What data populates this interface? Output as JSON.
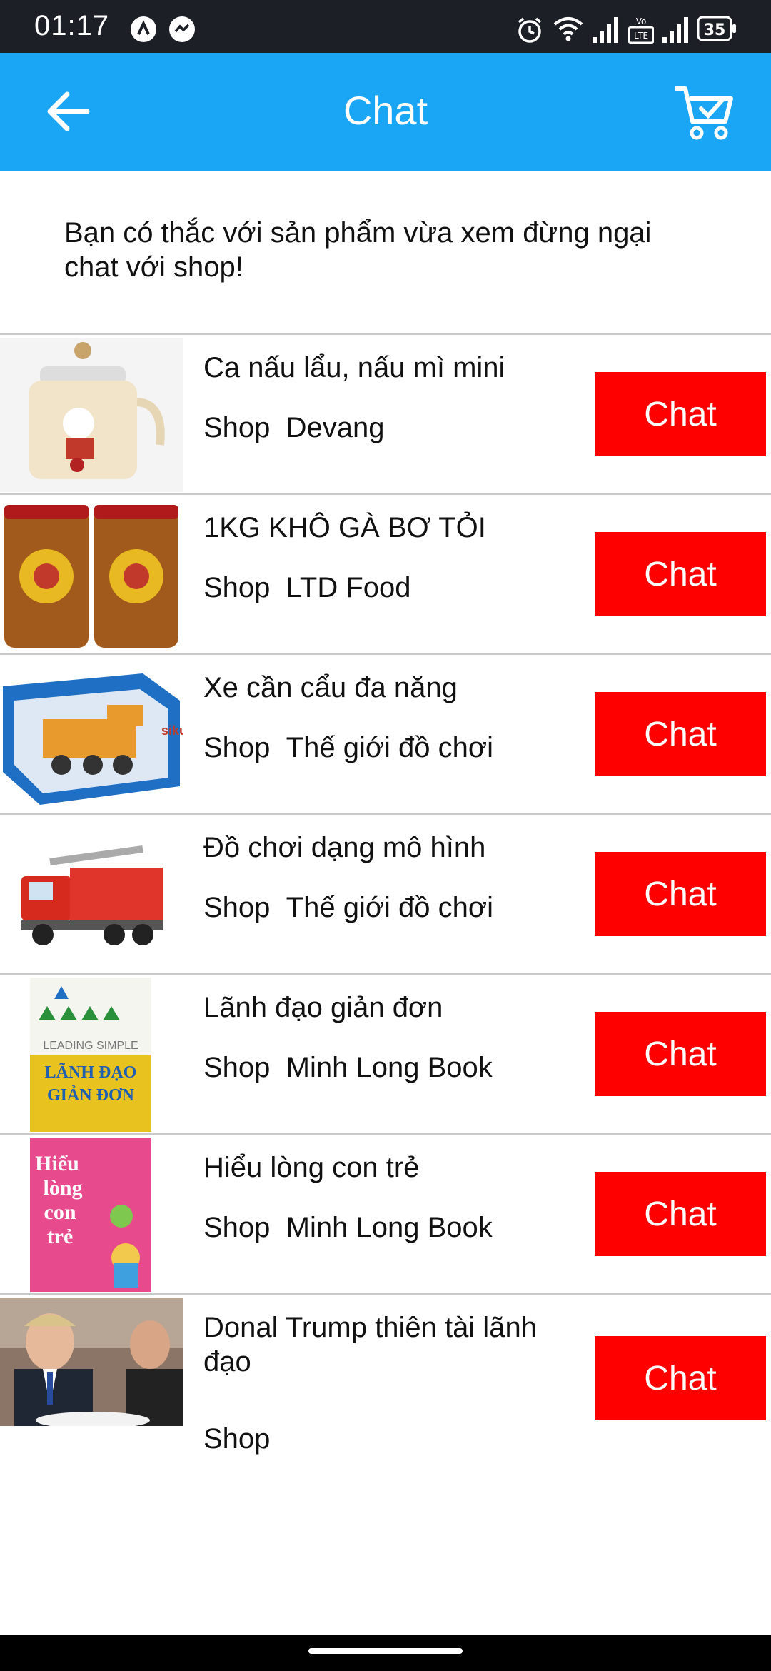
{
  "status": {
    "time": "01:17",
    "battery": "35",
    "volte_label": "VoLTE"
  },
  "header": {
    "title": "Chat",
    "back_icon": "arrow-left-icon",
    "cart_icon": "shopping-cart-icon"
  },
  "intro_text": "Bạn có thắc với sản phẩm vừa xem đừng ngại chat với shop!",
  "shop_prefix": "Shop",
  "items": [
    {
      "name": "Ca nấu lẩu, nấu mì mini",
      "shop": "Devang",
      "chat_label": "Chat"
    },
    {
      "name": "1KG KHÔ GÀ BƠ TỎI",
      "shop": "LTD Food",
      "chat_label": "Chat"
    },
    {
      "name": "Xe cần cẩu đa năng",
      "shop": "Thế giới đồ chơi",
      "chat_label": "Chat"
    },
    {
      "name": "Đồ chơi dạng mô hình",
      "shop": "Thế giới đồ chơi",
      "chat_label": "Chat"
    },
    {
      "name": "Lãnh đạo giản đơn",
      "shop": "Minh Long Book",
      "chat_label": "Chat"
    },
    {
      "name": "Hiểu lòng con trẻ",
      "shop": "Minh Long Book",
      "chat_label": "Chat"
    },
    {
      "name": "Donal Trump thiên tài lãnh đạo",
      "shop": "",
      "chat_label": "Chat"
    }
  ],
  "thumb_text": {
    "book1": {
      "line1": "LEADING SIMPLE",
      "line2": "LÃNH ĐẠO",
      "line3": "GIẢN ĐƠN"
    },
    "book2": {
      "line1": "Hiểu",
      "line2": "lòng",
      "line3": "con",
      "line4": "trẻ"
    },
    "toy_brand": "siku"
  },
  "colors": {
    "appbar": "#1aa6f5",
    "chat_button": "#ff0000",
    "statusbar": "#1c1f26"
  }
}
